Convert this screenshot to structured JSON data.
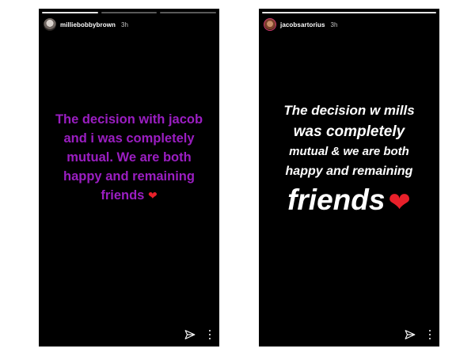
{
  "stories": [
    {
      "username": "milliebobbybrown",
      "time": "3h",
      "progress_segments": 3,
      "active_segment": 1,
      "text_color": "#9b1ec2",
      "lines": [
        "The decision with jacob",
        "and i was completely",
        "mutual. We are both",
        "happy and remaining",
        "friends"
      ],
      "emoji": "❤",
      "icons": [
        "send-icon",
        "more-options-icon"
      ]
    },
    {
      "username": "jacobsartorius",
      "time": "3h",
      "progress_segments": 1,
      "active_segment": 1,
      "text_color": "#ffffff",
      "lines": [
        "The decision w mills",
        "was completely",
        "mutual & we are both",
        "happy and remaining",
        "friends"
      ],
      "emoji": "❤",
      "icons": [
        "send-icon",
        "more-options-icon"
      ]
    }
  ]
}
